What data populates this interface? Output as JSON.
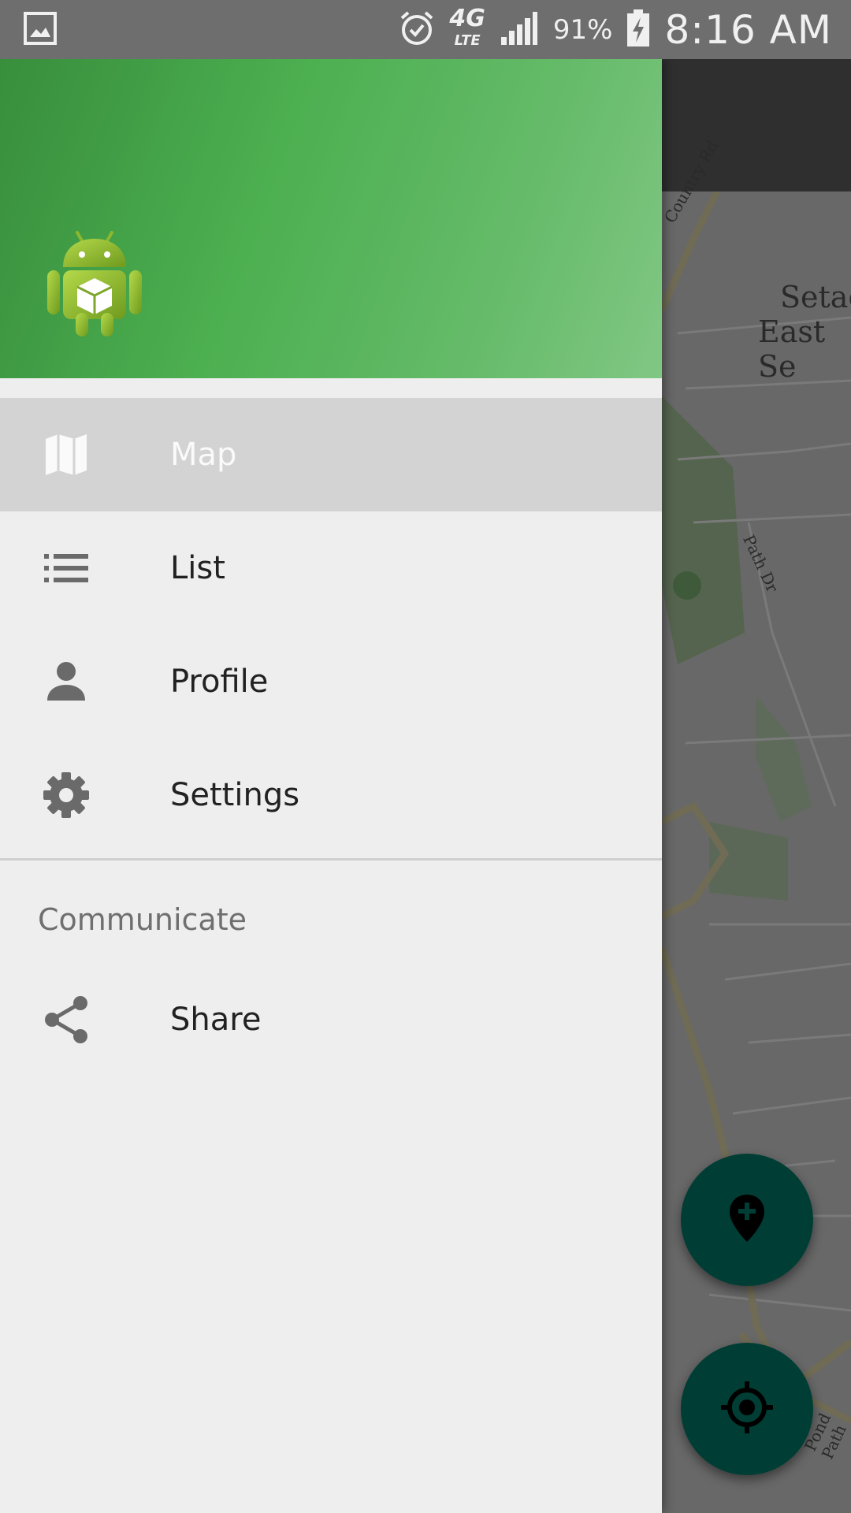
{
  "status_bar": {
    "network": "4G",
    "network_sub": "LTE",
    "battery": "91%",
    "time": "8:16 AM"
  },
  "drawer": {
    "items": [
      {
        "label": "Map",
        "icon": "map-icon",
        "active": true
      },
      {
        "label": "List",
        "icon": "list-icon",
        "active": false
      },
      {
        "label": "Profile",
        "icon": "person-icon",
        "active": false
      },
      {
        "label": "Settings",
        "icon": "gear-icon",
        "active": false
      }
    ],
    "section_title": "Communicate",
    "section_items": [
      {
        "label": "Share",
        "icon": "share-icon"
      }
    ]
  },
  "map": {
    "labels": {
      "country_rd": "Country Rd",
      "place_line1": "Setac",
      "place_line2": "East Se",
      "path_dr": "Path Dr",
      "pond_path": "Pond Path"
    }
  },
  "colors": {
    "header_green": "#4caf50",
    "fab": "#003e35",
    "active_item": "#d3d3d3"
  }
}
